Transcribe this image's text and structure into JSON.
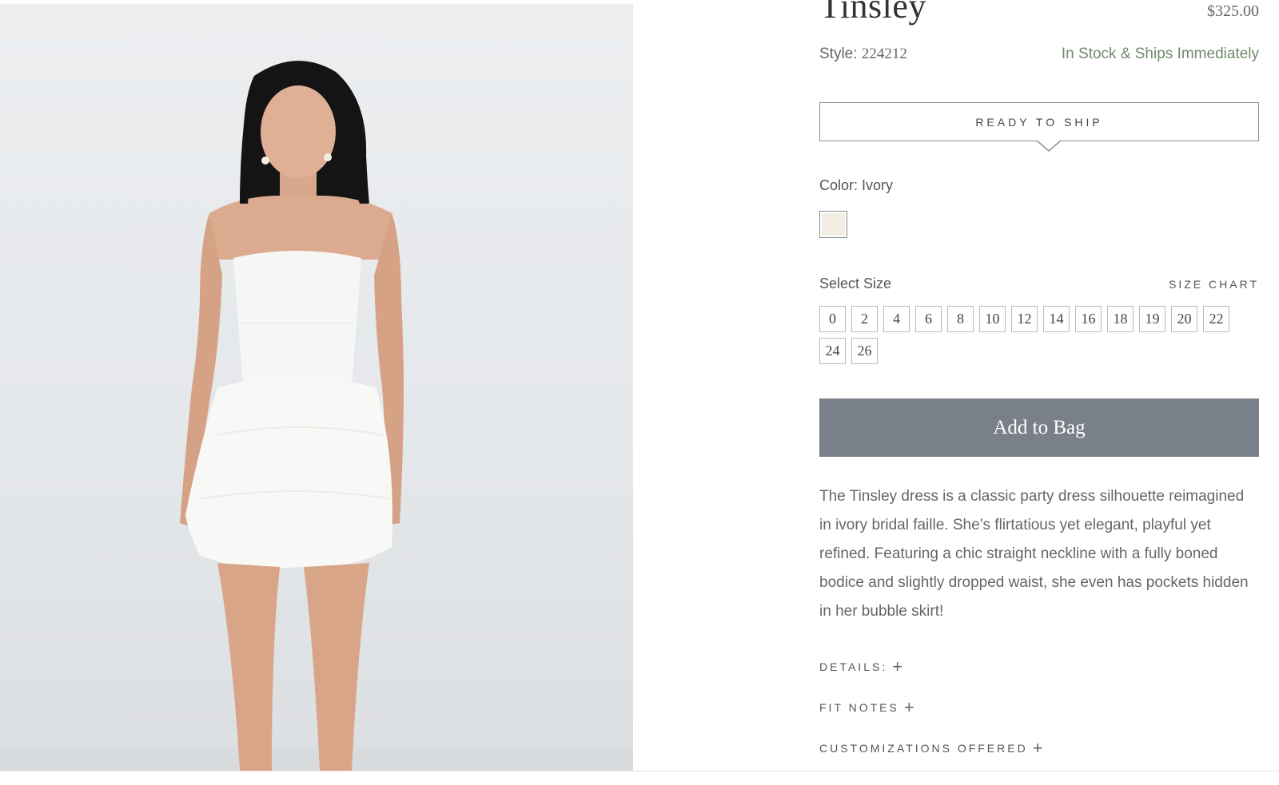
{
  "product": {
    "title": "Tinsley",
    "price": "$325.00",
    "style_label": "Style:",
    "style_number": "224212",
    "stock_status": "In Stock & Ships Immediately"
  },
  "ready_to_ship_tab": "READY TO SHIP",
  "color": {
    "label": "Color: Ivory",
    "swatch_hex": "#f3ede3"
  },
  "size": {
    "label": "Select Size",
    "chart_link": "SIZE CHART",
    "options": [
      "0",
      "2",
      "4",
      "6",
      "8",
      "10",
      "12",
      "14",
      "16",
      "18",
      "19",
      "20",
      "22",
      "24",
      "26"
    ]
  },
  "add_to_bag": "Add to Bag",
  "description": "The Tinsley dress is a classic party dress silhouette reimagined in ivory bridal faille. She’s flirtatious yet elegant, playful yet refined. Featuring a chic straight neckline with a fully boned bodice and slightly dropped waist, she even has pockets hidden in her bubble skirt!",
  "accordions": {
    "details": "DETAILS:",
    "fit_notes": "FIT NOTES",
    "customizations": "CUSTOMIZATIONS OFFERED",
    "icon": "plus-icon"
  },
  "colors": {
    "button_bg": "#7a8089",
    "stock_green": "#6f8a6b"
  }
}
